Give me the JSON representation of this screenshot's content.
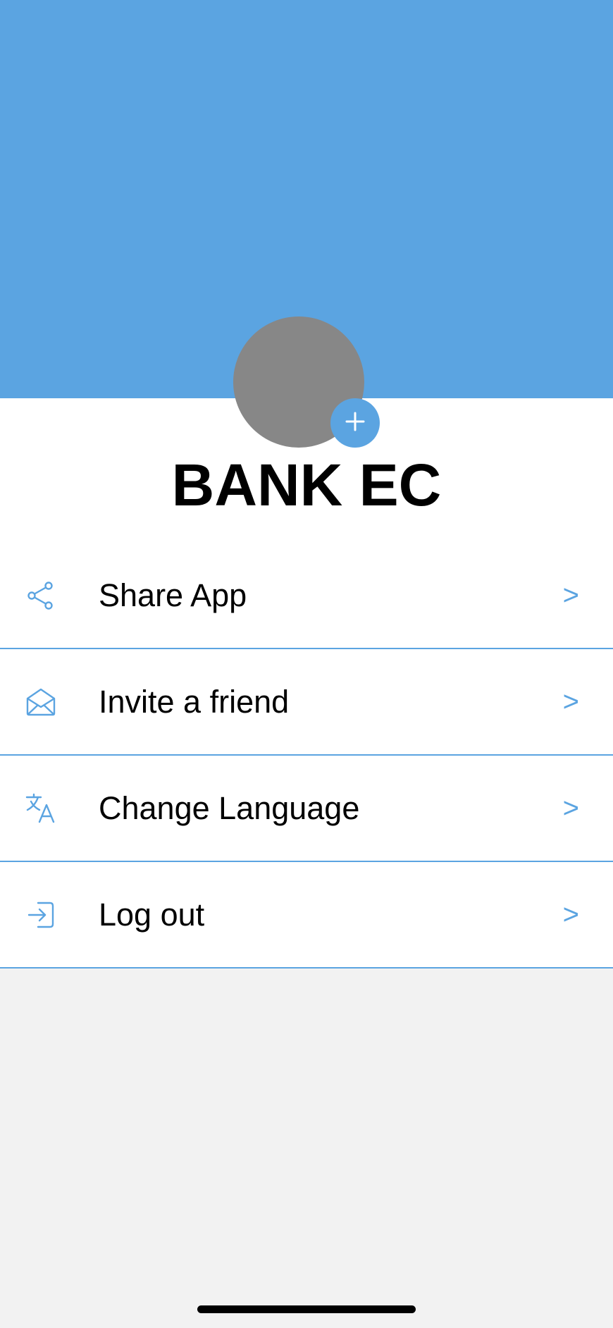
{
  "profile": {
    "name": "BANK EC",
    "add_photo_icon": "plus-icon"
  },
  "menu": {
    "items": [
      {
        "label": "Share App",
        "icon": "share-icon",
        "chevron": ">"
      },
      {
        "label": "Invite a friend",
        "icon": "envelope-icon",
        "chevron": ">"
      },
      {
        "label": "Change Language",
        "icon": "translate-icon",
        "chevron": ">"
      },
      {
        "label": "Log out",
        "icon": "logout-icon",
        "chevron": ">"
      }
    ]
  },
  "colors": {
    "accent": "#5ba4e1",
    "avatar": "#878787",
    "background": "#f2f2f2"
  }
}
